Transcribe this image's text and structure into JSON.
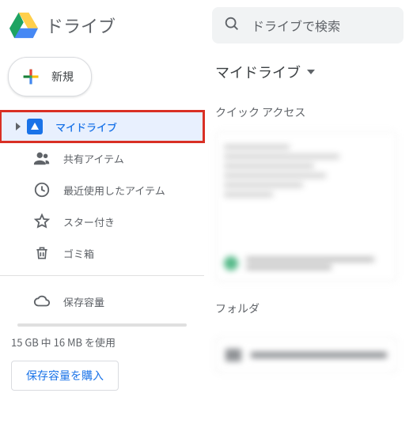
{
  "header": {
    "app_title": "ドライブ",
    "search_placeholder": "ドライブで検索"
  },
  "sidebar": {
    "new_label": "新規",
    "items": [
      {
        "id": "my-drive",
        "label": "マイドライブ",
        "selected": true,
        "expandable": true
      },
      {
        "id": "shared",
        "label": "共有アイテム"
      },
      {
        "id": "recent",
        "label": "最近使用したアイテム"
      },
      {
        "id": "starred",
        "label": "スター付き"
      },
      {
        "id": "trash",
        "label": "ゴミ箱"
      }
    ],
    "storage": {
      "label": "保存容量",
      "usage_text": "15 GB 中 16 MB を使用",
      "buy_label": "保存容量を購入"
    }
  },
  "main": {
    "breadcrumb": "マイドライブ",
    "quick_access_title": "クイック アクセス",
    "folders_title": "フォルダ"
  }
}
